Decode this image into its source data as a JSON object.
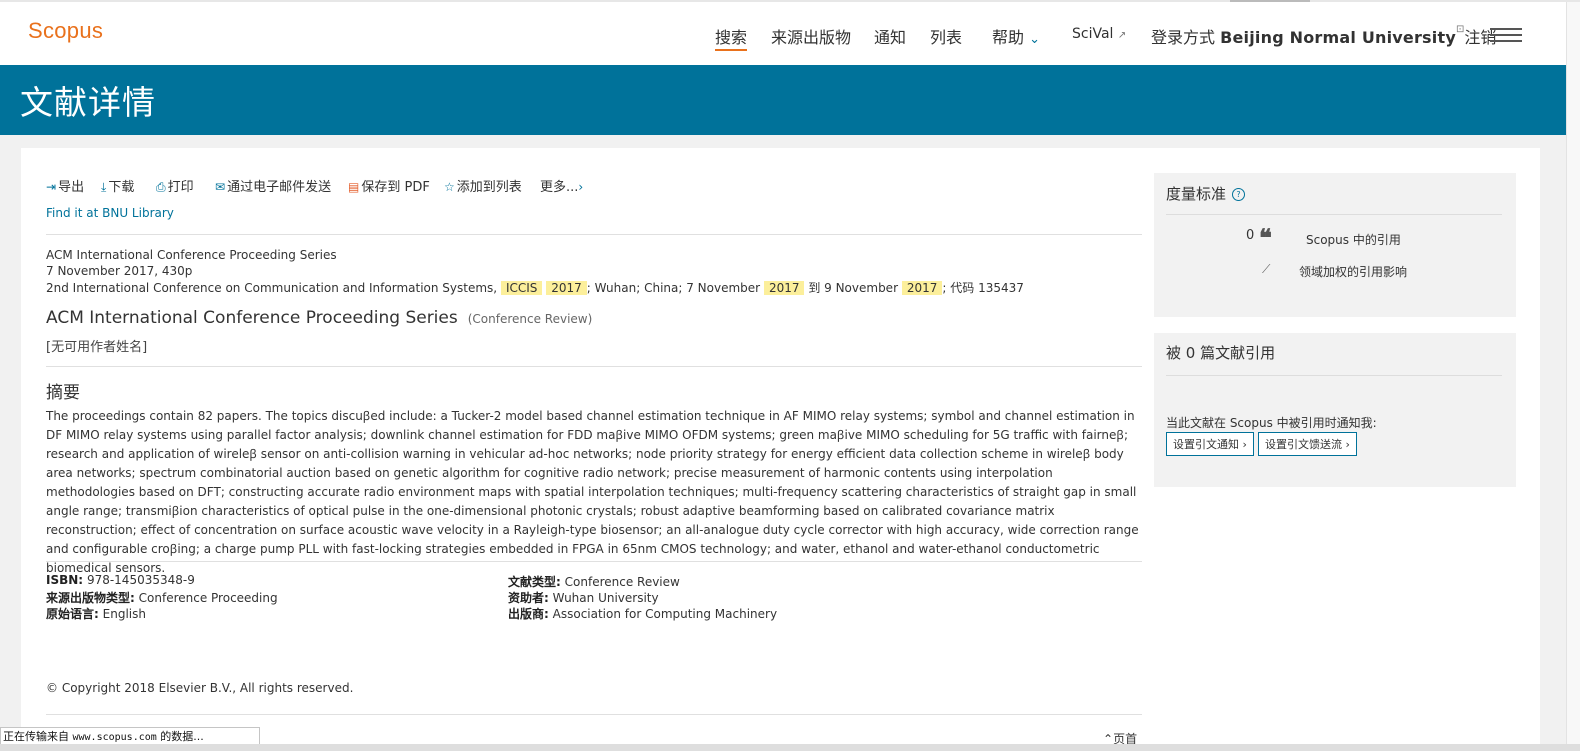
{
  "header": {
    "logo": "Scopus",
    "nav": {
      "search": "搜索",
      "sources": "来源出版物",
      "alerts": "通知",
      "lists": "列表",
      "help": "帮助",
      "scival": "SciVal",
      "login_prefix": "登录方式",
      "institution": "Beijing Normal University",
      "logout": "注销"
    }
  },
  "banner": {
    "title": "文献详情"
  },
  "toolbar": {
    "export": "导出",
    "download": "下载",
    "print": "打印",
    "email": "通过电子邮件发送",
    "save_pdf": "保存到 PDF",
    "add_list": "添加到列表",
    "more": "更多..."
  },
  "library_link": "Find it at BNU Library",
  "source_info": {
    "series": "ACM International Conference Proceeding Series",
    "date_pages": "7 November 2017, 430p",
    "conference_prefix": "2nd International Conference on Communication and Information Systems,",
    "acronym": "ICCIS",
    "year": "2017",
    "location_prefix": "; Wuhan; China; 7 November",
    "to": "到 9 November",
    "code": "; 代码 135437"
  },
  "document": {
    "title": "ACM International Conference Proceeding Series",
    "type": "(Conference Review)",
    "no_author": "[无可用作者姓名]"
  },
  "abstract": {
    "heading": "摘要",
    "text": "The proceedings contain 82 papers. The topics discuꞵed include: a Tucker-2 model based channel estimation technique in AF MIMO relay systems; symbol and channel estimation in DF MIMO relay systems using parallel factor analysis; downlink channel estimation for FDD maꞵive MIMO OFDM systems; green maꞵive MIMO scheduling for 5G traffic with fairneꞵ; research and application of wireleꞵ sensor on anti-collision warning in vehicular ad-hoc networks; node priority strategy for energy efficient data collection scheme in wireleꞵ body area networks; spectrum combinatorial auction based on genetic algorithm for cognitive radio network; precise measurement of harmonic contents using interpolation methodologies based on DFT; constructing accurate radio environment maps with spatial interpolation techniques; multi-frequency scattering characteristics of straight gap in small angle range; transmiꞵion characteristics of optical pulse in the one-dimensional photonic crystals; robust adaptive beamforming based on calibrated covariance matrix reconstruction; effect of concentration on surface acoustic wave velocity in a Rayleigh-type biosensor; an all-analogue duty cycle corrector with high accuracy, wide correction range and configurable croꞵing; a charge pump PLL with fast-locking strategies embedded in FPGA in 65nm CMOS technology; and water, ethanol and water-ethanol conductometric biomedical sensors."
  },
  "fields": {
    "isbn_label": "ISBN:",
    "isbn_value": "978-145035348-9",
    "source_type_label": "来源出版物类型:",
    "source_type_value": "Conference Proceeding",
    "language_label": "原始语言:",
    "language_value": "English",
    "doc_type_label": "文献类型:",
    "doc_type_value": "Conference Review",
    "sponsor_label": "资助者:",
    "sponsor_value": "Wuhan University",
    "publisher_label": "出版商:",
    "publisher_value": "Association for Computing Machinery"
  },
  "copyright": "© Copyright 2018 Elsevier B.V., All rights reserved.",
  "back_to_top": "页首",
  "metrics": {
    "heading": "度量标准",
    "citation_count": "0",
    "citations_label": "Scopus 中的引用",
    "fwci_label": "领域加权的引用影响"
  },
  "cited_by": {
    "heading": "被 0 篇文献引用",
    "alert_text": "当此文献在 Scopus 中被引用时通知我:",
    "set_alert": "设置引文通知",
    "set_feed": "设置引文馈送流"
  },
  "status_bar": {
    "prefix": "正在传输来自",
    "url": "www.scopus.com",
    "suffix": "的数据..."
  },
  "colors": {
    "brand_orange": "#e9711c",
    "banner_blue": "#00729a",
    "highlight": "#fcef9b"
  }
}
